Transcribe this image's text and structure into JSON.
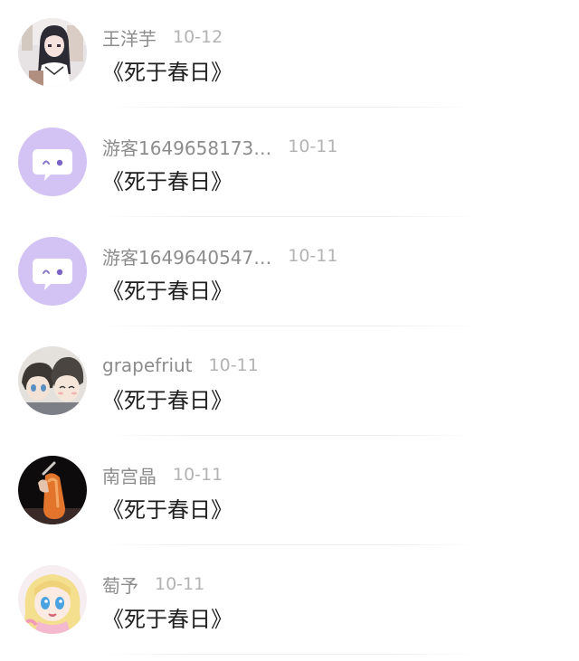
{
  "comments": [
    {
      "user": "王洋芋",
      "date": "10-12",
      "text": "《死于春日》",
      "avatar": "anime-girl-avatar"
    },
    {
      "user": "游客1649658173…",
      "date": "10-11",
      "text": "《死于春日》",
      "avatar": "guest-chat-bubble-avatar"
    },
    {
      "user": "游客1649640547…",
      "date": "10-11",
      "text": "《死于春日》",
      "avatar": "guest-chat-bubble-avatar"
    },
    {
      "user": "grapefriut",
      "date": "10-11",
      "text": "《死于春日》",
      "avatar": "anime-boys-avatar"
    },
    {
      "user": "南宫晶",
      "date": "10-11",
      "text": "《死于春日》",
      "avatar": "sausage-photo-avatar"
    },
    {
      "user": "萄予",
      "date": "10-11",
      "text": "《死于春日》",
      "avatar": "blonde-anime-girl-avatar"
    }
  ],
  "colors": {
    "name": "#8c8c8c",
    "time": "#b3b3b3",
    "text": "#1f1f1f",
    "guest_avatar_bg": "#d3c3f5"
  }
}
